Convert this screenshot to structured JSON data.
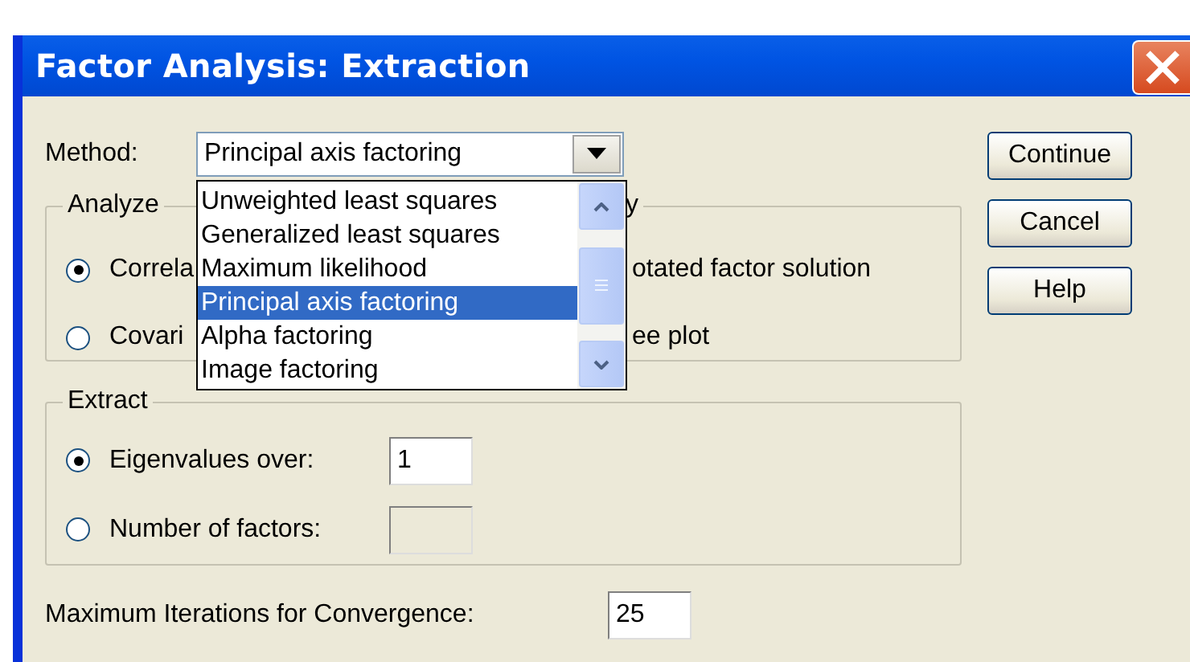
{
  "window": {
    "title": "Factor Analysis: Extraction"
  },
  "method": {
    "label": "Method:",
    "value": "Principal axis factoring",
    "expanded": true,
    "options": [
      {
        "label": "Unweighted least squares",
        "selected": false
      },
      {
        "label": "Generalized least squares",
        "selected": false
      },
      {
        "label": "Maximum likelihood",
        "selected": false
      },
      {
        "label": "Principal axis factoring",
        "selected": true
      },
      {
        "label": "Alpha factoring",
        "selected": false
      },
      {
        "label": "Image factoring",
        "selected": false
      }
    ]
  },
  "analyze": {
    "legend": "Analyze",
    "options": [
      {
        "label": "Correla",
        "selected": true
      },
      {
        "label": "Covari",
        "selected": false
      }
    ]
  },
  "display": {
    "legend": "y",
    "options": [
      {
        "label": "otated factor solution"
      },
      {
        "label": "ee plot"
      }
    ]
  },
  "extract": {
    "legend": "Extract",
    "options": [
      {
        "label": "Eigenvalues over:",
        "selected": true,
        "value": "1",
        "disabled": false
      },
      {
        "label": "Number of factors:",
        "selected": false,
        "disabled": true
      }
    ]
  },
  "iterations": {
    "label": "Maximum Iterations for Convergence:",
    "value": "25"
  },
  "buttons": [
    "Continue",
    "Cancel",
    "Help"
  ]
}
